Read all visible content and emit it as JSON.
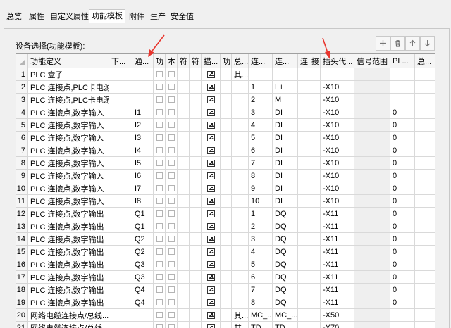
{
  "tabs": [
    {
      "label": "总览"
    },
    {
      "label": "属性"
    },
    {
      "label": "自定义属性"
    },
    {
      "label": "功能模板"
    },
    {
      "label": "附件"
    },
    {
      "label": "生产"
    },
    {
      "label": "安全值"
    }
  ],
  "active_tab": "功能模板",
  "section_title": "设备选择(功能模板):",
  "toolbar": {
    "add_icon": "plus-icon",
    "delete_icon": "trash-icon",
    "up_icon": "arrow-up-icon",
    "down_icon": "arrow-down-icon"
  },
  "table": {
    "columns": [
      "功能定义",
      "下...",
      "通...",
      "功",
      "本",
      "符",
      "符",
      "描...",
      "功",
      "总...",
      "连...",
      "连...",
      "连",
      "接",
      "插头代...",
      "信号范围",
      "PL...",
      "总..."
    ],
    "rows": [
      {
        "n": "1",
        "def": "PLC 盒子",
        "ch": "",
        "desc": true,
        "total": "其...",
        "c1": "",
        "c2": "",
        "plug": "",
        "pl": ""
      },
      {
        "n": "2",
        "def": "PLC 连接点,PLC卡电源...",
        "ch": "",
        "desc": true,
        "total": "",
        "c1": "1",
        "c2": "L+",
        "plug": "-X10",
        "pl": ""
      },
      {
        "n": "3",
        "def": "PLC 连接点,PLC卡电源...",
        "ch": "",
        "desc": true,
        "total": "",
        "c1": "2",
        "c2": "M",
        "plug": "-X10",
        "pl": ""
      },
      {
        "n": "4",
        "def": "PLC 连接点,数字输入",
        "ch": "I1",
        "desc": true,
        "total": "",
        "c1": "3",
        "c2": "DI",
        "plug": "-X10",
        "pl": "0"
      },
      {
        "n": "5",
        "def": "PLC 连接点,数字输入",
        "ch": "I2",
        "desc": true,
        "total": "",
        "c1": "4",
        "c2": "DI",
        "plug": "-X10",
        "pl": "0"
      },
      {
        "n": "6",
        "def": "PLC 连接点,数字输入",
        "ch": "I3",
        "desc": true,
        "total": "",
        "c1": "5",
        "c2": "DI",
        "plug": "-X10",
        "pl": "0"
      },
      {
        "n": "7",
        "def": "PLC 连接点,数字输入",
        "ch": "I4",
        "desc": true,
        "total": "",
        "c1": "6",
        "c2": "DI",
        "plug": "-X10",
        "pl": "0"
      },
      {
        "n": "8",
        "def": "PLC 连接点,数字输入",
        "ch": "I5",
        "desc": true,
        "total": "",
        "c1": "7",
        "c2": "DI",
        "plug": "-X10",
        "pl": "0"
      },
      {
        "n": "9",
        "def": "PLC 连接点,数字输入",
        "ch": "I6",
        "desc": true,
        "total": "",
        "c1": "8",
        "c2": "DI",
        "plug": "-X10",
        "pl": "0"
      },
      {
        "n": "10",
        "def": "PLC 连接点,数字输入",
        "ch": "I7",
        "desc": true,
        "total": "",
        "c1": "9",
        "c2": "DI",
        "plug": "-X10",
        "pl": "0"
      },
      {
        "n": "11",
        "def": "PLC 连接点,数字输入",
        "ch": "I8",
        "desc": true,
        "total": "",
        "c1": "10",
        "c2": "DI",
        "plug": "-X10",
        "pl": "0"
      },
      {
        "n": "12",
        "def": "PLC 连接点,数字输出",
        "ch": "Q1",
        "desc": true,
        "total": "",
        "c1": "1",
        "c2": "DQ",
        "plug": "-X11",
        "pl": "0"
      },
      {
        "n": "13",
        "def": "PLC 连接点,数字输出",
        "ch": "Q1",
        "desc": true,
        "total": "",
        "c1": "2",
        "c2": "DQ",
        "plug": "-X11",
        "pl": "0"
      },
      {
        "n": "14",
        "def": "PLC 连接点,数字输出",
        "ch": "Q2",
        "desc": true,
        "total": "",
        "c1": "3",
        "c2": "DQ",
        "plug": "-X11",
        "pl": "0"
      },
      {
        "n": "15",
        "def": "PLC 连接点,数字输出",
        "ch": "Q2",
        "desc": true,
        "total": "",
        "c1": "4",
        "c2": "DQ",
        "plug": "-X11",
        "pl": "0"
      },
      {
        "n": "16",
        "def": "PLC 连接点,数字输出",
        "ch": "Q3",
        "desc": true,
        "total": "",
        "c1": "5",
        "c2": "DQ",
        "plug": "-X11",
        "pl": "0"
      },
      {
        "n": "17",
        "def": "PLC 连接点,数字输出",
        "ch": "Q3",
        "desc": true,
        "total": "",
        "c1": "6",
        "c2": "DQ",
        "plug": "-X11",
        "pl": "0"
      },
      {
        "n": "18",
        "def": "PLC 连接点,数字输出",
        "ch": "Q4",
        "desc": true,
        "total": "",
        "c1": "7",
        "c2": "DQ",
        "plug": "-X11",
        "pl": "0"
      },
      {
        "n": "19",
        "def": "PLC 连接点,数字输出",
        "ch": "Q4",
        "desc": true,
        "total": "",
        "c1": "8",
        "c2": "DQ",
        "plug": "-X11",
        "pl": "0"
      },
      {
        "n": "20",
        "def": "网络电缆连接点/总线...",
        "ch": "",
        "desc": true,
        "total": "其...",
        "c1": "MC_...",
        "c2": "MC_...",
        "plug": "-X50",
        "pl": ""
      },
      {
        "n": "21",
        "def": "网络电缆连接点/总线...",
        "ch": "",
        "desc": true,
        "total": "其...",
        "c1": "TD",
        "c2": "TD",
        "plug": "-X70",
        "pl": ""
      }
    ]
  },
  "annotation_color": "#e8342c"
}
